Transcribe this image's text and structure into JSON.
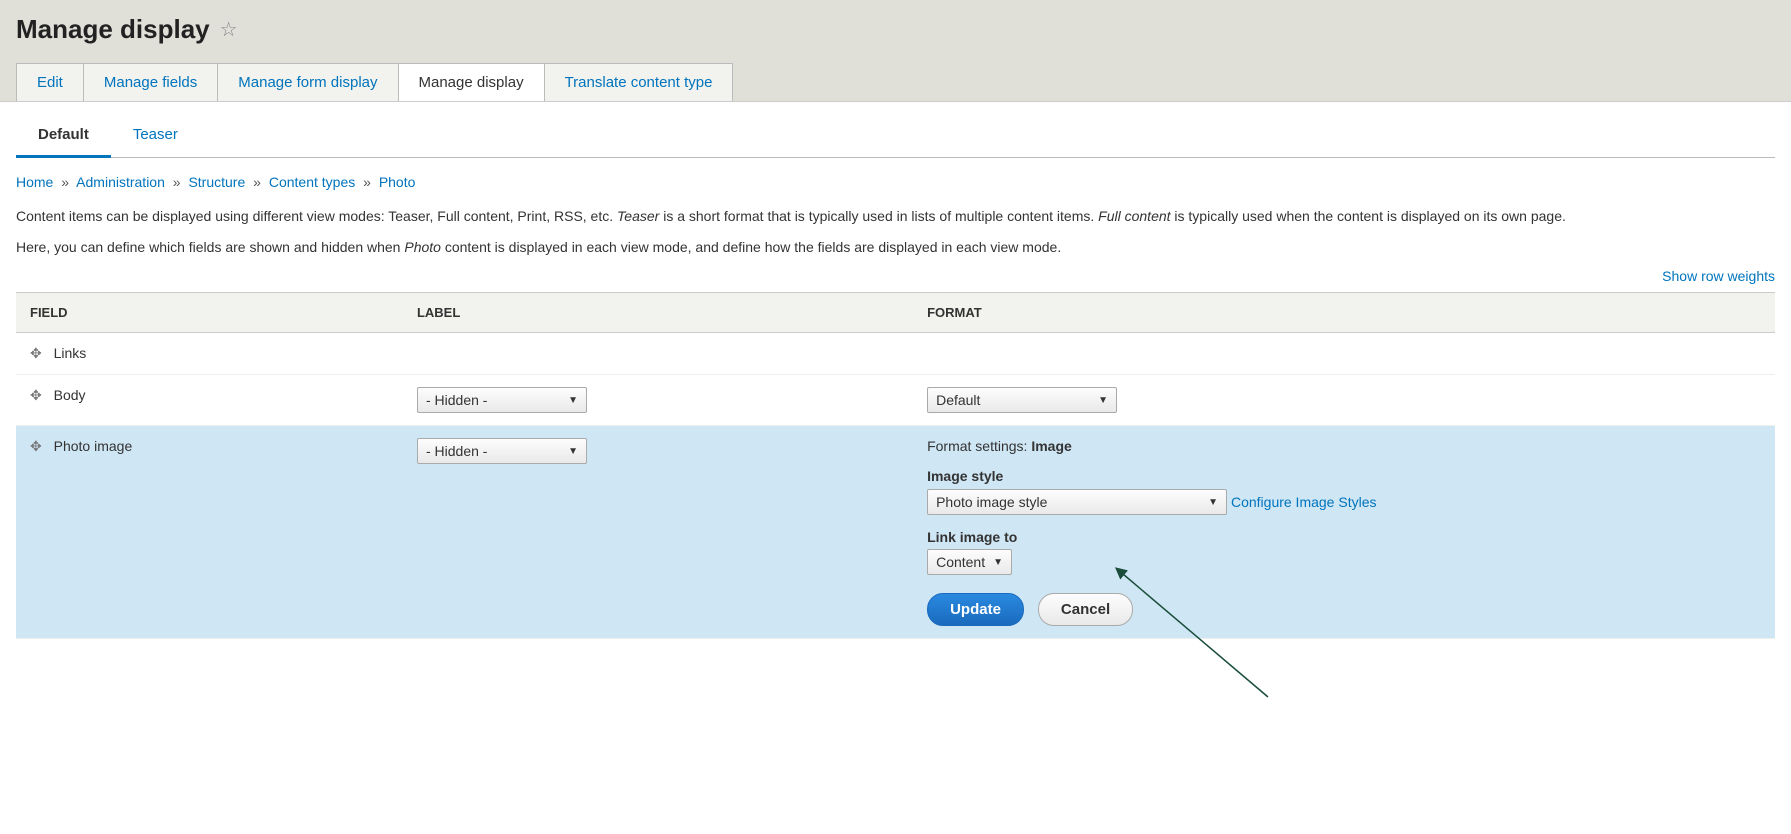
{
  "page_title": "Manage display",
  "primary_tabs": {
    "edit": "Edit",
    "manage_fields": "Manage fields",
    "manage_form_display": "Manage form display",
    "manage_display": "Manage display",
    "translate_content_type": "Translate content type"
  },
  "secondary_tabs": {
    "default": "Default",
    "teaser": "Teaser"
  },
  "breadcrumb": {
    "home": "Home",
    "administration": "Administration",
    "structure": "Structure",
    "content_types": "Content types",
    "photo": "Photo"
  },
  "description": {
    "part1": "Content items can be displayed using different view modes: Teaser, Full content, Print, RSS, etc. ",
    "teaser": "Teaser",
    "part2": " is a short format that is typically used in lists of multiple content items. ",
    "full_content": "Full content",
    "part3": " is typically used when the content is displayed on its own page.",
    "line2a": "Here, you can define which fields are shown and hidden when ",
    "line2b": "Photo",
    "line2c": " content is displayed in each view mode, and define how the fields are displayed in each view mode."
  },
  "show_row_weights": "Show row weights",
  "table": {
    "headers": {
      "field": "FIELD",
      "label": "LABEL",
      "format": "FORMAT"
    },
    "rows": {
      "links": {
        "field": "Links"
      },
      "body": {
        "field": "Body",
        "label_select": "- Hidden -",
        "format_select": "Default"
      },
      "photo_image": {
        "field": "Photo image",
        "label_select": "- Hidden -",
        "format_settings_prefix": "Format settings: ",
        "format_settings_value": "Image",
        "image_style_label": "Image style",
        "image_style_value": "Photo image style",
        "configure_link": "Configure Image Styles",
        "link_image_label": "Link image to",
        "link_image_value": "Content",
        "update_button": "Update",
        "cancel_button": "Cancel"
      }
    }
  }
}
